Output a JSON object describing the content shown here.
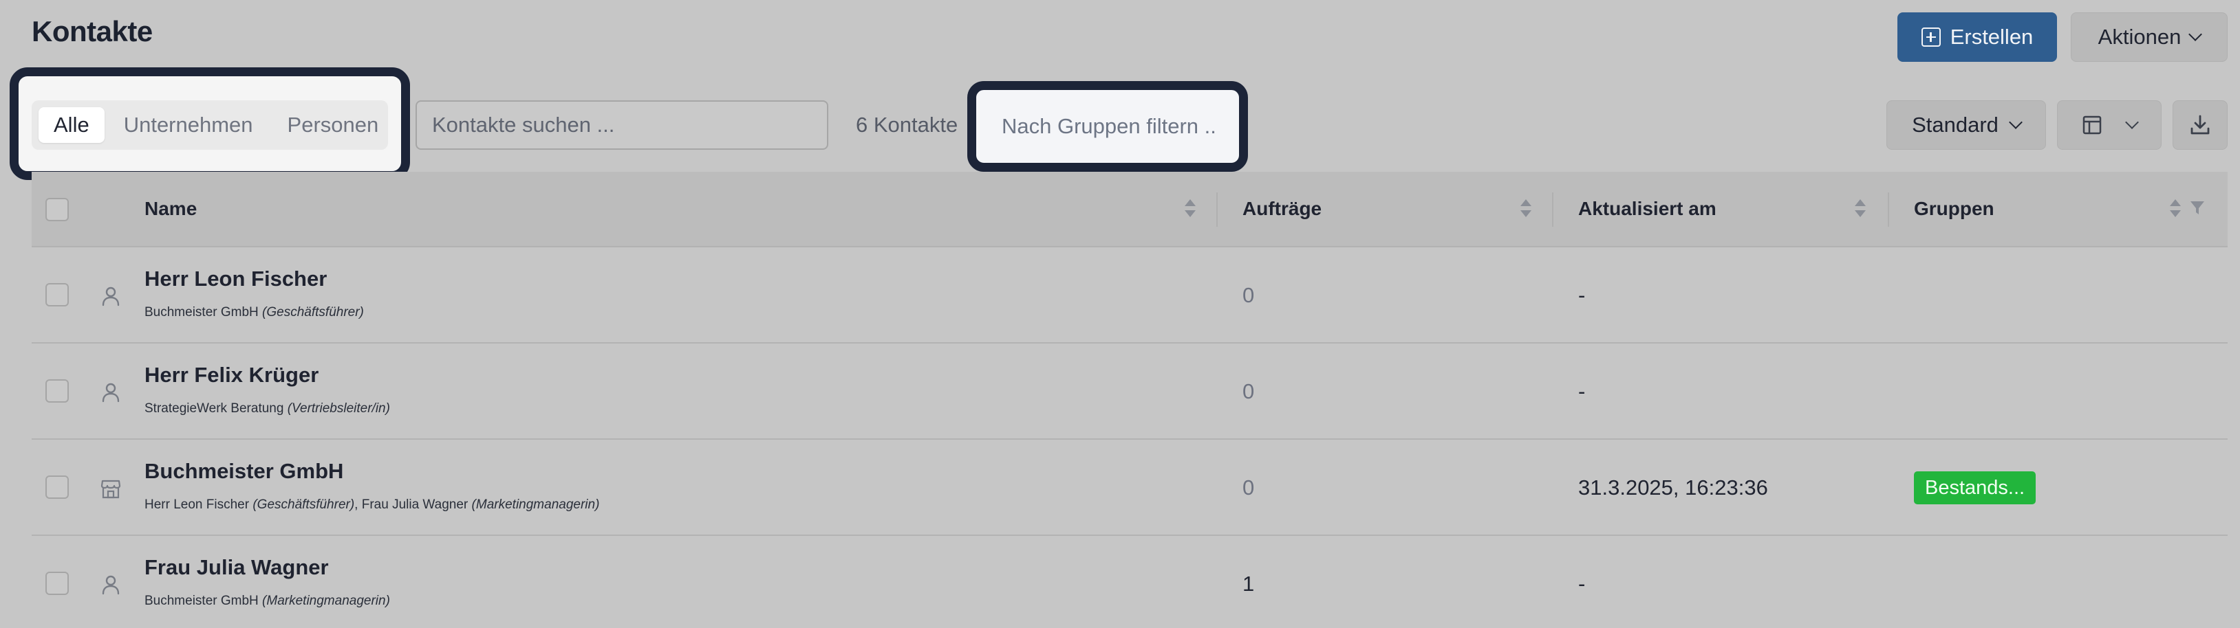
{
  "header": {
    "title": "Kontakte",
    "create_label": "Erstellen",
    "actions_label": "Aktionen"
  },
  "filters": {
    "segments": [
      "Alle",
      "Unternehmen",
      "Personen"
    ],
    "active_segment": "Alle",
    "search_placeholder": "Kontakte suchen ...",
    "count_text": "6 Kontakte",
    "group_placeholder": "Nach Gruppen filtern ...",
    "view_label": "Standard"
  },
  "table": {
    "columns": {
      "name": "Name",
      "orders": "Aufträge",
      "updated": "Aktualisiert am",
      "groups": "Gruppen"
    },
    "rows": [
      {
        "type": "person",
        "name": "Herr Leon Fischer",
        "sub_a": "Buchmeister GmbH ",
        "sub_a_role": "(Geschäftsführer)",
        "sub_b": "",
        "sub_b_role": "",
        "orders": "0",
        "updated": "-",
        "group": ""
      },
      {
        "type": "person",
        "name": "Herr Felix Krüger",
        "sub_a": "StrategieWerk Beratung ",
        "sub_a_role": "(Vertriebsleiter/in)",
        "sub_b": "",
        "sub_b_role": "",
        "orders": "0",
        "updated": "-",
        "group": ""
      },
      {
        "type": "company",
        "name": "Buchmeister GmbH",
        "sub_a": "Herr Leon Fischer ",
        "sub_a_role": "(Geschäftsführer)",
        "sub_b": ", Frau Julia Wagner ",
        "sub_b_role": "(Marketingmanagerin)",
        "orders": "0",
        "updated": "31.3.2025, 16:23:36",
        "group": "Bestands..."
      },
      {
        "type": "person",
        "name": "Frau Julia Wagner",
        "sub_a": "Buchmeister GmbH ",
        "sub_a_role": "(Marketingmanagerin)",
        "sub_b": "",
        "sub_b_role": "",
        "orders": "1",
        "updated": "-",
        "group": ""
      }
    ]
  },
  "colors": {
    "primary": "#2f5d8f",
    "badge_green": "#22b53c",
    "highlight_frame": "#1c2438"
  },
  "icons": [
    "plus-square-icon",
    "chevron-down-icon",
    "columns-layout-icon",
    "download-icon",
    "sort-icon",
    "filter-icon",
    "person-icon",
    "company-icon"
  ]
}
